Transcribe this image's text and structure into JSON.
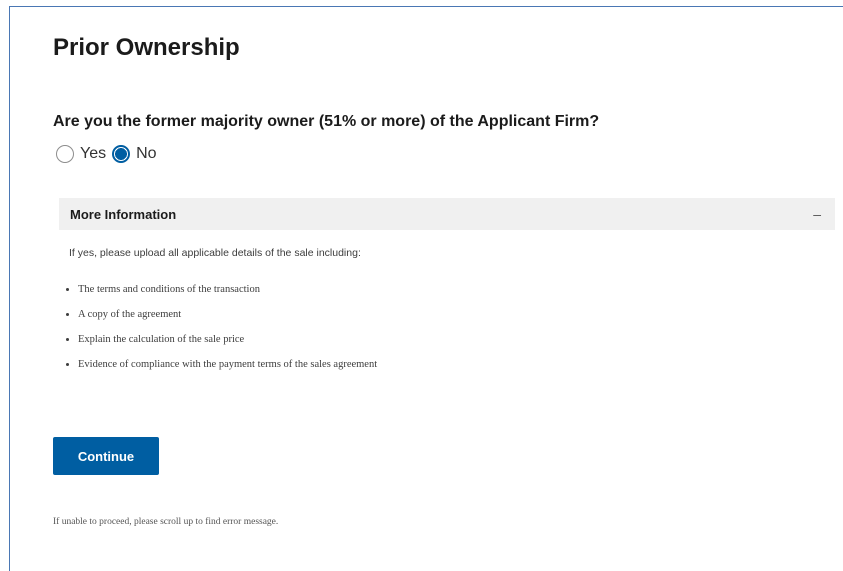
{
  "page": {
    "title": "Prior Ownership"
  },
  "question": {
    "text": "Are you the former majority owner (51% or more) of the Applicant Firm?",
    "options": [
      {
        "label": "Yes",
        "selected": false
      },
      {
        "label": "No",
        "selected": true
      }
    ]
  },
  "more_info": {
    "title": "More Information",
    "toggle": "–",
    "intro": "If yes, please upload all applicable details of the sale including:",
    "items": [
      "The terms and conditions of the transaction",
      "A copy of the agreement",
      "Explain the calculation of the sale price",
      "Evidence of compliance with the payment terms of the sales agreement"
    ]
  },
  "actions": {
    "continue_label": "Continue"
  },
  "footer": {
    "help_text": "If unable to proceed, please scroll up to find error message."
  },
  "colors": {
    "primary": "#005ea2",
    "accordion_bg": "#f0f0f0",
    "frame_border": "#4a77b4"
  }
}
